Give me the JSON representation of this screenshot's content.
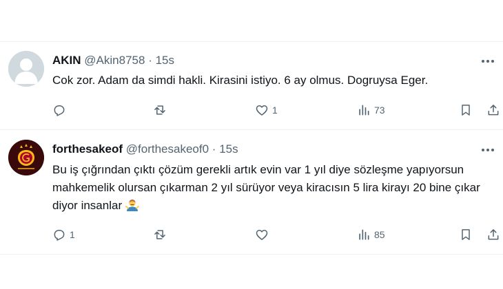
{
  "tweets": [
    {
      "name": "AKIN",
      "handle": "@Akin8758",
      "separator": "·",
      "time": "15s",
      "text": "Cok zor. Adam da simdi hakli. Kirasini istiyo. 6 ay olmus. Dogruysa Eger.",
      "replies": "",
      "retweets": "",
      "likes": "1",
      "views": "73",
      "avatar": "default-avatar"
    },
    {
      "name": "forthesakeof",
      "handle": "@forthesakeof0",
      "separator": "·",
      "time": "15s",
      "text": "Bu iş çığrından çıktı çözüm gerekli artık evin var 1 yıl diye sözleşme yapıyorsun mahkemelik olursan çıkarman 2 yıl sürüyor veya kiracısın 5 lira kirayı 20 bine çıkar diyor insanlar",
      "emoji": "man-shrugging",
      "replies": "1",
      "retweets": "",
      "likes": "",
      "views": "85",
      "avatar": "galatasaray-crest"
    }
  ],
  "icons": {
    "reply": "reply-icon",
    "retweet": "retweet-icon",
    "like": "heart-icon",
    "views": "views-icon",
    "bookmark": "bookmark-icon",
    "share": "share-icon",
    "more": "more-icon"
  },
  "colors": {
    "text": "#0f1419",
    "secondary": "#536471",
    "divider": "#eff3f4",
    "club_red": "#a90432",
    "club_yellow": "#fdb912"
  }
}
